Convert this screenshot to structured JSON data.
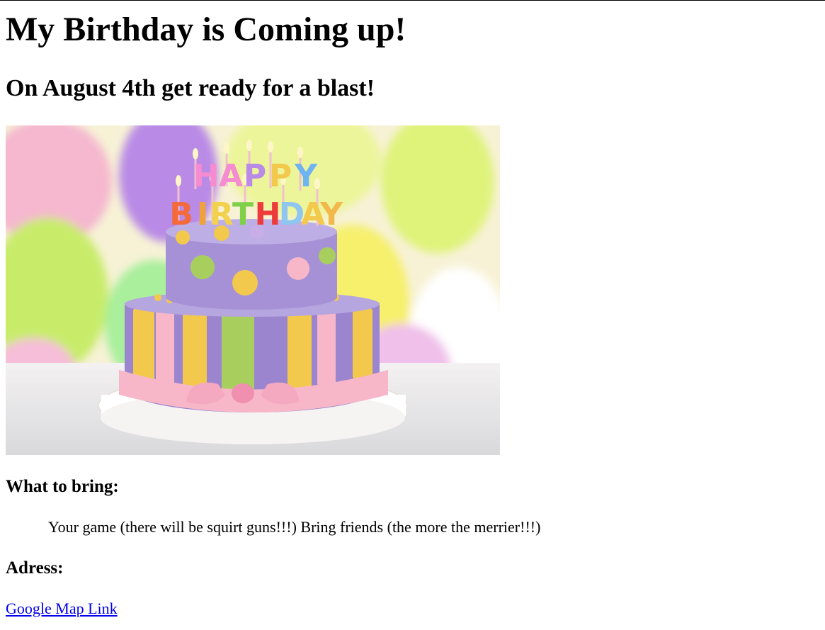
{
  "page": {
    "title": "My Birthday is Coming up!",
    "subtitle": "On August 4th get ready for a blast!"
  },
  "image": {
    "cake_letters_top": "HAPPY",
    "cake_letters_bottom": "BIRTHDAY"
  },
  "bring": {
    "heading": "What to bring:",
    "text": "Your game (there will be squirt guns!!!) Bring friends (the more the merrier!!!)"
  },
  "address": {
    "heading": "Adress:",
    "link_label": "Google Map Link"
  },
  "colors": {
    "link": "#0000ee",
    "cake_purple": "#9b85cf",
    "cake_pink": "#f7b7c8",
    "cake_yellow": "#f2c94c",
    "cake_green": "#a8cf5e"
  }
}
